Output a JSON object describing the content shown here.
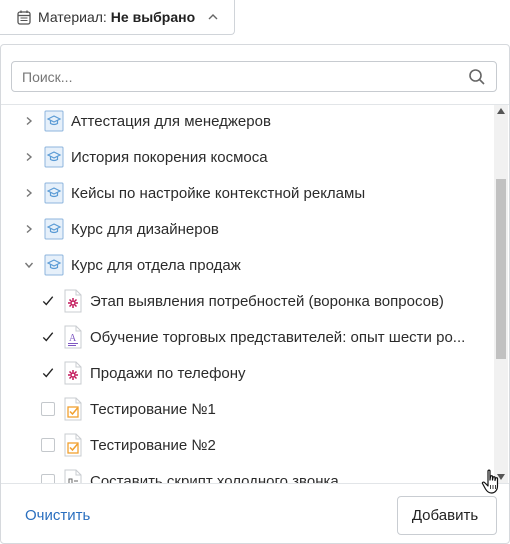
{
  "filter": {
    "label": "Материал:",
    "value": "Не выбрано"
  },
  "search": {
    "placeholder": "Поиск..."
  },
  "courses": [
    {
      "label": "Аттестация для менеджеров",
      "expanded": false
    },
    {
      "label": "История покорения космоса",
      "expanded": false
    },
    {
      "label": "Кейсы по настройке контекстной рекламы",
      "expanded": false
    },
    {
      "label": "Курс для дизайнеров",
      "expanded": false
    },
    {
      "label": "Курс для отдела продаж",
      "expanded": true
    }
  ],
  "materials": [
    {
      "label": "Этап выявления потребностей (воронка вопросов)",
      "checked": true,
      "icon": "interactive-icon"
    },
    {
      "label": "Обучение торговых представителей: опыт шести ро...",
      "checked": true,
      "icon": "text-document-icon"
    },
    {
      "label": "Продажи по телефону",
      "checked": true,
      "icon": "interactive-icon"
    },
    {
      "label": "Тестирование №1",
      "checked": false,
      "icon": "test-icon"
    },
    {
      "label": "Тестирование №2",
      "checked": false,
      "icon": "test-icon"
    },
    {
      "label": "Составить скрипт холодного звонка",
      "checked": false,
      "icon": "assignment-icon"
    }
  ],
  "footer": {
    "clear_label": "Очистить",
    "add_label": "Добавить"
  },
  "colors": {
    "accent_link": "#2a6fbf",
    "course_icon": "#5b9bd5",
    "check": "#222222",
    "interactive_icon": "#c2185b",
    "text_icon": "#7e57c2",
    "test_icon": "#f0a030"
  }
}
